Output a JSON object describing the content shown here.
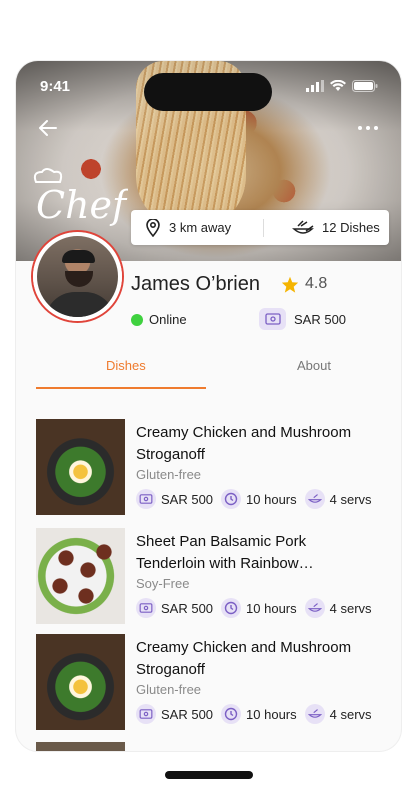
{
  "status_bar": {
    "time": "9:41"
  },
  "chef": {
    "logo_text": "Chef",
    "distance": "3 km away",
    "dishes_count": "12 Dishes",
    "name": "James O’brien",
    "rating": "4.8",
    "status": "Online",
    "price": "SAR 500"
  },
  "tabs": [
    {
      "label": "Dishes",
      "active": true
    },
    {
      "label": "About",
      "active": false
    }
  ],
  "dishes": [
    {
      "title": "Creamy Chicken and Mushroom Stroganoff",
      "tag": "Gluten-free",
      "price": "SAR 500",
      "time": "10 hours",
      "servings": "4 servs"
    },
    {
      "title": "Sheet Pan Balsamic Pork Tenderloin with Rainbow…",
      "tag": "Soy-Free",
      "price": "SAR 500",
      "time": "10 hours",
      "servings": "4 servs"
    },
    {
      "title": "Creamy Chicken and Mushroom Stroganoff",
      "tag": "Gluten-free",
      "price": "SAR 500",
      "time": "10 hours",
      "servings": "4 servs"
    }
  ],
  "colors": {
    "accent": "#ef7b2e",
    "online": "#3fd13f",
    "icon_bg": "#e7e1f6",
    "icon": "#7b5fc4",
    "star": "#f5b400"
  },
  "icons": [
    "back-arrow-icon",
    "more-icon",
    "location-pin-icon",
    "cooking-icon",
    "star-icon",
    "money-icon",
    "clock-icon",
    "servings-icon"
  ]
}
